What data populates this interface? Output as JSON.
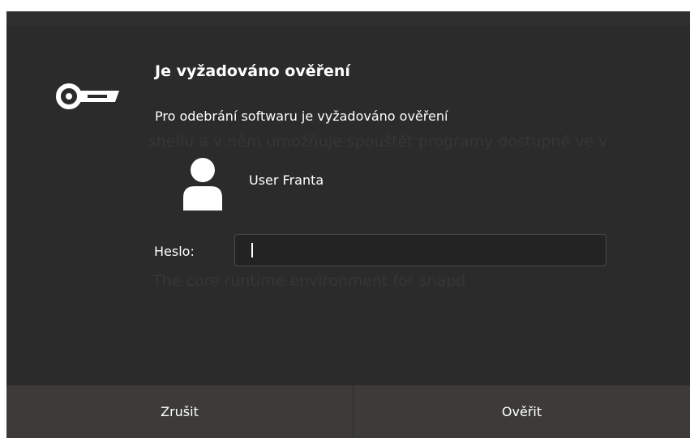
{
  "dialog": {
    "title": "Je vyžadováno ověření",
    "message": "Pro odebrání softwaru je vyžadováno ověření",
    "user": {
      "name": "User Franta",
      "icon": "user-avatar-icon"
    },
    "lock_icon": "key-icon",
    "password": {
      "label": "Heslo:",
      "value": "",
      "placeholder": ""
    },
    "buttons": {
      "cancel": "Zrušit",
      "confirm": "Ověřit"
    }
  },
  "background": {
    "line1": "shellu a v něm umožňuje spouštět programy dostupné ve v",
    "line2": "The core runtime environment for snapd"
  },
  "colors": {
    "dialog_bg": "#2b2b2b",
    "button_bar_bg": "#3c3b37",
    "text": "#ffffff",
    "input_bg": "#232323"
  }
}
